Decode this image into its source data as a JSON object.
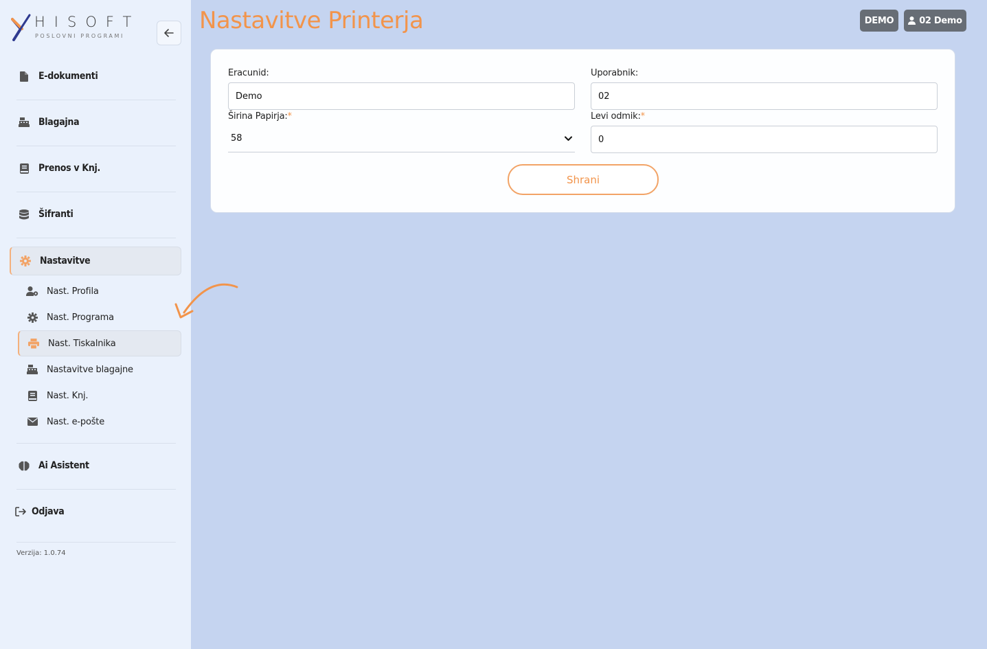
{
  "brand": {
    "name": "HISOFT",
    "tagline": "POSLOVNI PROGRAMI"
  },
  "header": {
    "title": "Nastavitve Printerja",
    "env_badge": "DEMO",
    "user_badge": "02 Demo"
  },
  "sidebar": {
    "items": [
      {
        "label": "E-dokumenti",
        "icon": "file-icon"
      },
      {
        "label": "Blagajna",
        "icon": "cash-register-icon"
      },
      {
        "label": "Prenos v Knj.",
        "icon": "book-icon"
      },
      {
        "label": "Šifranti",
        "icon": "database-icon"
      },
      {
        "label": "Nastavitve",
        "icon": "gear-icon",
        "active": true
      }
    ],
    "subitems": [
      {
        "label": "Nast. Profila",
        "icon": "user-gear-icon"
      },
      {
        "label": "Nast. Programa",
        "icon": "gear-icon"
      },
      {
        "label": "Nast. Tiskalnika",
        "icon": "printer-icon",
        "active": true
      },
      {
        "label": "Nastavitve blagajne",
        "icon": "cash-register-icon"
      },
      {
        "label": "Nast. Knj.",
        "icon": "book-icon"
      },
      {
        "label": "Nast. e-pošte",
        "icon": "envelope-icon"
      }
    ],
    "bottom_items": [
      {
        "label": "Ai Asistent",
        "icon": "brain-icon"
      },
      {
        "label": "Odjava",
        "icon": "logout-icon"
      }
    ],
    "version": "Verzija: 1.0.74"
  },
  "form": {
    "eracunid_label": "Eracunid:",
    "eracunid_value": "Demo",
    "uporabnik_label": "Uporabnik:",
    "uporabnik_value": "02",
    "sirina_label": "Širina Papirja:",
    "sirina_value": "58",
    "levi_label": "Levi odmik:",
    "levi_value": "0",
    "required_mark": "*",
    "save_label": "Shrani"
  },
  "colors": {
    "accent": "#f2944b",
    "background": "#c5d4f0",
    "sidebar": "#eaf1fc",
    "badge": "#676d75"
  }
}
